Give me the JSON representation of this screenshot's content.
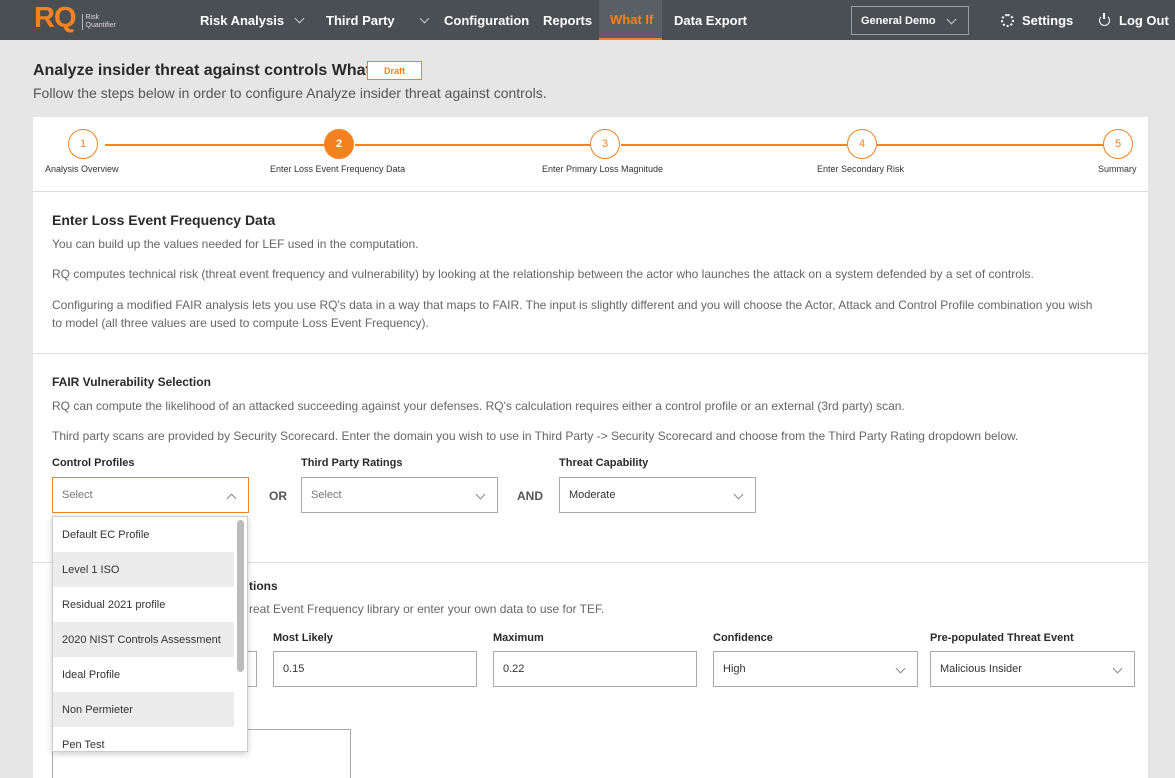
{
  "nav": {
    "logo_mark": "RQ",
    "logo_text_1": "Risk",
    "logo_text_2": "Quantifier",
    "items": [
      {
        "label": "Risk Analysis"
      },
      {
        "label": "Third Party"
      },
      {
        "label": "Configuration"
      },
      {
        "label": "Reports"
      },
      {
        "label": "What If"
      },
      {
        "label": "Data Export"
      }
    ],
    "workspace": "General Demo",
    "settings": "Settings",
    "logout": "Log Out"
  },
  "header": {
    "title": "Analyze insider threat against controls What If",
    "badge": "Draft",
    "subtitle": "Follow the steps below in order to configure Analyze insider threat against controls."
  },
  "steps": [
    {
      "num": "1",
      "label": "Analysis Overview"
    },
    {
      "num": "2",
      "label": "Enter Loss Event Frequency Data"
    },
    {
      "num": "3",
      "label": "Enter Primary Loss Magnitude"
    },
    {
      "num": "4",
      "label": "Enter Secondary Risk"
    },
    {
      "num": "5",
      "label": "Summary"
    }
  ],
  "lef": {
    "heading": "Enter Loss Event Frequency Data",
    "p1": "You can build up the values needed for LEF used in the computation.",
    "p2": "RQ computes technical risk (threat event frequency and vulnerability) by looking at the relationship between the actor who launches the attack on a system defended by a set of controls.",
    "p3": "Configuring a modified FAIR analysis lets you use RQ's data in a way that maps to FAIR. The input is slightly different and you will choose the Actor, Attack and Control Profile combination you wish to model (all three values are used to compute Loss Event Frequency)."
  },
  "vuln": {
    "heading": "FAIR Vulnerability Selection",
    "p1": "RQ can compute the likelihood of an attacked succeeding against your defenses. RQ's calculation requires either a control profile or an external (3rd party) scan.",
    "p2": "Third party scans are provided by Security Scorecard. Enter the domain you wish to use in Third Party -> Security Scorecard and choose from the Third Party Rating dropdown below.",
    "control_label": "Control Profiles",
    "control_value": "Select",
    "or": "OR",
    "third_label": "Third Party Ratings",
    "third_value": "Select",
    "and": "AND",
    "capability_label": "Threat Capability",
    "capability_value": "Moderate"
  },
  "dropdown_options": [
    "Default EC Profile",
    "Level 1 ISO",
    "Residual 2021 profile",
    "2020 NIST Controls Assessment",
    "Ideal Profile",
    "Non Permieter",
    "Pen Test"
  ],
  "tef": {
    "heading_partial": "tions",
    "desc_partial": "reat Event Frequency library or enter your own data to use for TEF.",
    "most_likely_label": "Most Likely",
    "most_likely_value": "0.15",
    "maximum_label": "Maximum",
    "maximum_value": "0.22",
    "confidence_label": "Confidence",
    "confidence_value": "High",
    "threat_event_label": "Pre-populated Threat Event",
    "threat_event_value": "Malicious Insider"
  }
}
